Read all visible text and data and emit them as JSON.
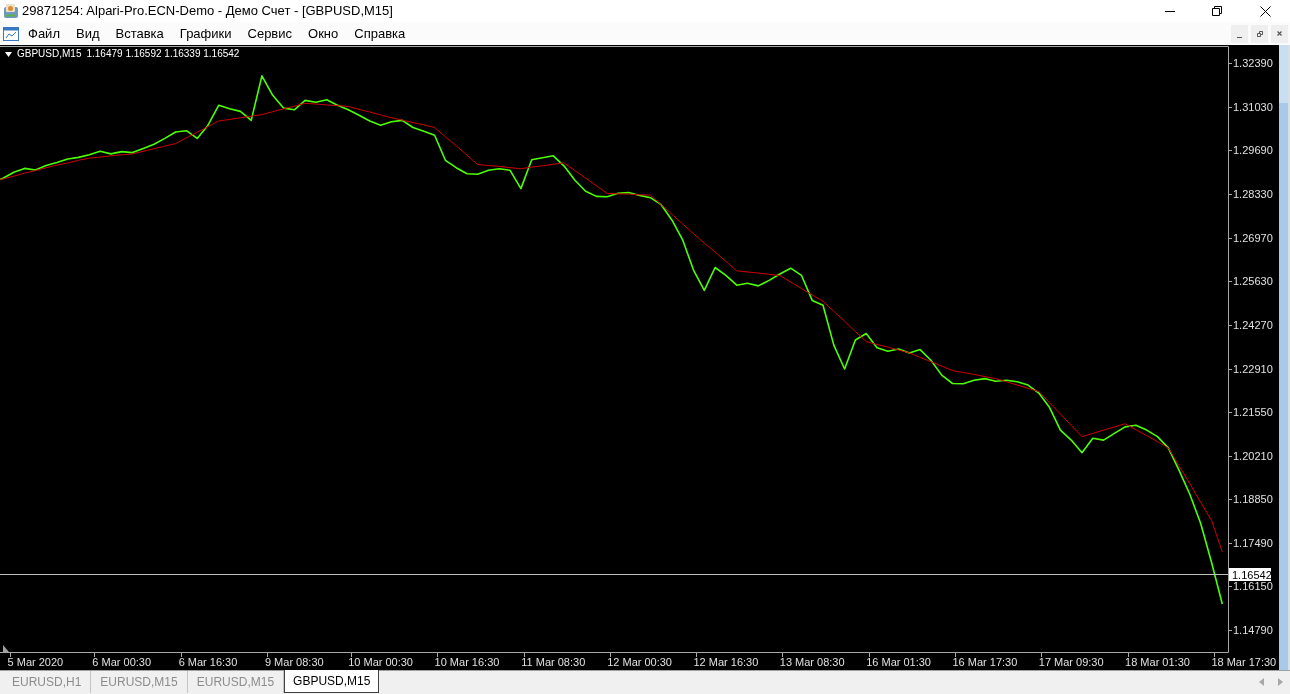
{
  "window": {
    "title": "29871254: Alpari-Pro.ECN-Demo - Демо Счет - [GBPUSD,M15]"
  },
  "menu": [
    {
      "label": "Файл"
    },
    {
      "label": "Вид"
    },
    {
      "label": "Вставка"
    },
    {
      "label": "Графики"
    },
    {
      "label": "Сервис"
    },
    {
      "label": "Окно"
    },
    {
      "label": "Справка"
    }
  ],
  "chart": {
    "chart_data": [
      {
        "type": "line",
        "title": "GBPUSD,M15",
        "subtitle": "1.16479 1.16592 1.16339 1.16542",
        "ylim": [
          1.1411,
          1.3293
        ],
        "categories": [
          null,
          null,
          null,
          null,
          "5 Mar 2020",
          null,
          null,
          null,
          null,
          null,
          null,
          null,
          "6 Mar 00:30",
          null,
          null,
          null,
          null,
          null,
          null,
          null,
          "6 Mar 16:30",
          null,
          null,
          null,
          null,
          null,
          null,
          null,
          "9 Mar 08:30",
          null,
          null,
          null,
          null,
          null,
          null,
          null,
          "10 Mar 00:30",
          null,
          null,
          null,
          null,
          null,
          null,
          null,
          "10 Mar 16:30",
          null,
          null,
          null,
          null,
          null,
          null,
          null,
          "11 Mar 08:30",
          null,
          null,
          null,
          null,
          null,
          null,
          null,
          "12 Mar 00:30",
          null,
          null,
          null,
          null,
          null,
          null,
          null,
          "12 Mar 16:30",
          null,
          null,
          null,
          null,
          null,
          null,
          null,
          "13 Mar 08:30",
          null,
          null,
          null,
          null,
          null,
          null,
          null,
          "16 Mar 01:30",
          null,
          null,
          null,
          null,
          null,
          null,
          null,
          "16 Mar 17:30",
          null,
          null,
          null,
          null,
          null,
          null,
          null,
          "17 Mar 09:30",
          null,
          null,
          null,
          null,
          null,
          null,
          null,
          "18 Mar 01:30",
          null,
          null,
          null,
          null,
          null,
          null,
          null,
          "18 Mar 17:30"
        ],
        "yticks": [
          {
            "value": 1.3239,
            "label": "1.32390"
          },
          {
            "value": 1.3103,
            "label": "1.31030"
          },
          {
            "value": 1.2969,
            "label": "1.29690"
          },
          {
            "value": 1.2833,
            "label": "1.28330"
          },
          {
            "value": 1.2697,
            "label": "1.26970"
          },
          {
            "value": 1.2563,
            "label": "1.25630"
          },
          {
            "value": 1.2427,
            "label": "1.24270"
          },
          {
            "value": 1.2291,
            "label": "1.22910"
          },
          {
            "value": 1.2155,
            "label": "1.21550"
          },
          {
            "value": 1.2021,
            "label": "1.20210"
          },
          {
            "value": 1.1885,
            "label": "1.18850"
          },
          {
            "value": 1.1749,
            "label": "1.17490"
          },
          {
            "value": 1.1615,
            "label": "1.16150"
          },
          {
            "value": 1.1479,
            "label": "1.14790"
          }
        ],
        "ref_lines": [
          {
            "axis": "y",
            "value": 1.16542,
            "label": "1.16542",
            "color": "#c0c0c0"
          }
        ],
        "series": [
          {
            "color": "#4cff00",
            "values": [
              1.287,
              1.2882,
              1.2901,
              1.2913,
              1.2908,
              1.2922,
              1.2931,
              1.2942,
              1.2947,
              1.2955,
              1.2966,
              1.2958,
              1.2965,
              1.2962,
              1.2975,
              1.2988,
              1.3006,
              1.3026,
              1.303,
              1.3006,
              1.3047,
              1.3109,
              1.3098,
              1.309,
              1.3062,
              1.32,
              1.314,
              1.31,
              1.3095,
              1.3124,
              1.3118,
              1.3126,
              1.3109,
              1.3095,
              1.3078,
              1.306,
              1.3047,
              1.3058,
              1.3062,
              1.304,
              1.3028,
              1.3016,
              1.2938,
              1.2915,
              1.2896,
              1.2895,
              1.2907,
              1.2912,
              1.2907,
              1.285,
              1.294,
              1.2946,
              1.2952,
              1.292,
              1.2876,
              1.2842,
              1.2826,
              1.2825,
              1.2836,
              1.2838,
              1.2829,
              1.2822,
              1.28,
              1.2752,
              1.269,
              1.2597,
              1.2534,
              1.2605,
              1.2581,
              1.255,
              1.2556,
              1.2548,
              1.2565,
              1.2585,
              1.2603,
              1.2581,
              1.2503,
              1.2488,
              1.2364,
              1.229,
              1.238,
              1.24,
              1.2356,
              1.2345,
              1.2352,
              1.234,
              1.235,
              1.2317,
              1.2271,
              1.2245,
              1.2244,
              1.2255,
              1.226,
              1.2252,
              1.2255,
              1.225,
              1.224,
              1.2215,
              1.217,
              1.21,
              1.2069,
              1.203,
              1.2075,
              1.2069,
              1.209,
              1.211,
              1.2115,
              1.21,
              1.208,
              1.2045,
              1.1975,
              1.19,
              1.181,
              1.169,
              1.156,
              null,
              null
            ]
          },
          {
            "color": "#d00000",
            "values": [
              1.2876,
              1.288,
              1.2889,
              1.2898,
              1.2906,
              1.2915,
              1.2923,
              1.293,
              1.2938,
              1.2945,
              1.2948,
              1.2952,
              1.2955,
              1.2958,
              1.2966,
              1.2974,
              1.2982,
              1.299,
              1.3008,
              1.3025,
              1.3043,
              1.306,
              1.3065,
              1.307,
              1.3075,
              1.308,
              1.3089,
              1.3098,
              1.3106,
              1.3115,
              1.3113,
              1.311,
              1.3108,
              1.3105,
              1.3096,
              1.3088,
              1.3079,
              1.307,
              1.3063,
              1.3055,
              1.3048,
              1.304,
              1.3011,
              1.2983,
              1.2954,
              1.2925,
              1.2922,
              1.2919,
              1.2915,
              1.2912,
              1.2917,
              1.2921,
              1.2926,
              1.293,
              1.2906,
              1.2883,
              1.2859,
              1.2835,
              1.2834,
              1.2833,
              1.2831,
              1.283,
              1.28,
              1.277,
              1.274,
              1.271,
              1.2681,
              1.2653,
              1.2624,
              1.2595,
              1.2591,
              1.2588,
              1.2584,
              1.258,
              1.256,
              1.254,
              1.252,
              1.25,
              1.2469,
              1.2438,
              1.2406,
              1.2375,
              1.2366,
              1.2358,
              1.2349,
              1.234,
              1.2326,
              1.2313,
              1.2299,
              1.2285,
              1.2279,
              1.2273,
              1.2266,
              1.226,
              1.225,
              1.224,
              1.223,
              1.222,
              1.2185,
              1.215,
              1.2115,
              1.208,
              1.209,
              1.21,
              1.211,
              1.212,
              1.2101,
              1.2083,
              1.2064,
              1.2045,
              1.1989,
              1.1933,
              1.1876,
              1.182,
              1.1722,
              null,
              null
            ]
          }
        ]
      }
    ]
  },
  "tabs": [
    {
      "label": "EURUSD,H1",
      "selected": false
    },
    {
      "label": "EURUSD,M15",
      "selected": false
    },
    {
      "label": "EURUSD,M15",
      "selected": false
    },
    {
      "label": "GBPUSD,M15",
      "selected": true
    }
  ]
}
